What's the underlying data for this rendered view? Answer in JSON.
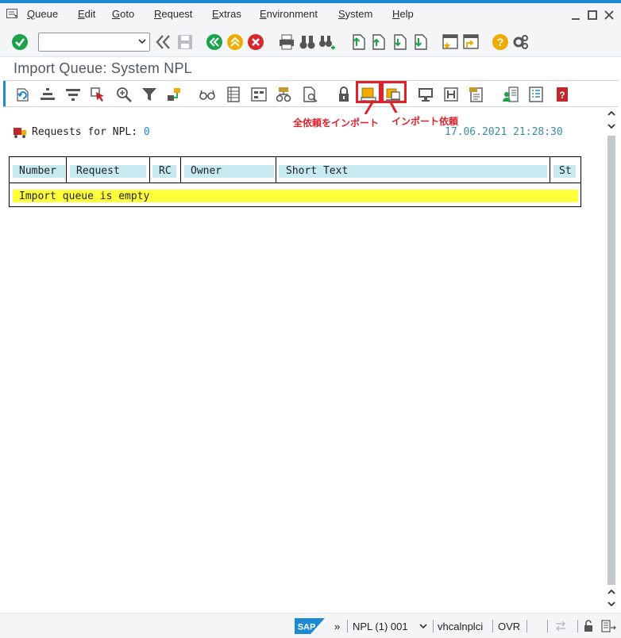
{
  "menubar": {
    "items": [
      "Queue",
      "Edit",
      "Goto",
      "Request",
      "Extras",
      "Environment",
      "System",
      "Help"
    ]
  },
  "toolbar": {
    "command_field_value": ""
  },
  "page": {
    "title": "Import Queue: System NPL"
  },
  "app_toolbar": {
    "icons": [
      "refresh-icon",
      "sort-ascending-icon",
      "filter-list-icon",
      "select-cursor-icon",
      "zoom-icon",
      "filter-icon",
      "transport-icon",
      "glasses-icon",
      "document-columns-icon",
      "layout-icon",
      "hierarchy-icon",
      "document-search-icon",
      "lock-icon",
      "import-all-requests-icon",
      "import-request-icon",
      "monitor-icon",
      "history-icon",
      "log-icon",
      "user-list-icon",
      "list-icon",
      "help-book-icon"
    ]
  },
  "annotations": {
    "import_all": "全依頼をインポート",
    "import_request": "インポート依頼"
  },
  "content": {
    "requests_label": "Requests for NPL:",
    "requests_count": "0",
    "timestamp": "17.06.2021 21:28:30",
    "columns": [
      "Number",
      "Request",
      "RC",
      "Owner",
      "Short Text",
      "St"
    ],
    "empty_message": "Import queue is empty"
  },
  "statusbar": {
    "sap_logo": "SAP",
    "chevron": "»",
    "system": "NPL (1) 001",
    "server": "vhcalnplci",
    "mode": "OVR"
  },
  "colors": {
    "accent": "#1e88d4",
    "highlight": "#e0202a",
    "empty_row": "#ffff3a",
    "header_cell": "#c7eaf0"
  }
}
